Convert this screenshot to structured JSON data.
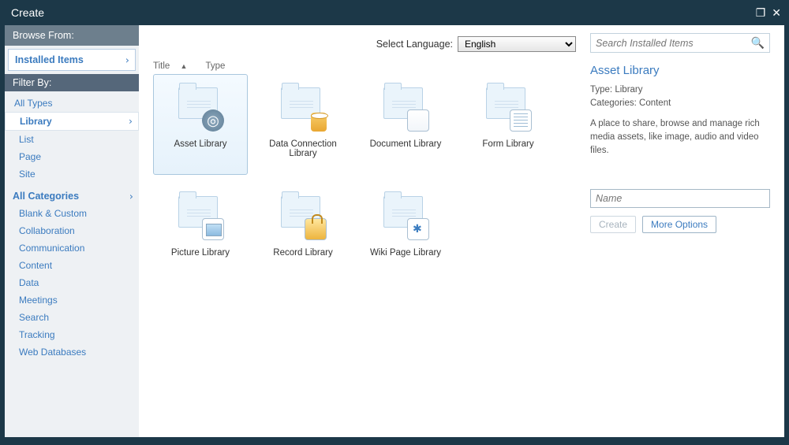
{
  "window": {
    "title": "Create"
  },
  "sidebar": {
    "browse_from": "Browse From:",
    "installed_items": "Installed Items",
    "filter_by": "Filter By:",
    "all_types": "All Types",
    "types": [
      "Library",
      "List",
      "Page",
      "Site"
    ],
    "selected_type_index": 0,
    "all_categories": "All Categories",
    "categories": [
      "Blank & Custom",
      "Collaboration",
      "Communication",
      "Content",
      "Data",
      "Meetings",
      "Search",
      "Tracking",
      "Web Databases"
    ]
  },
  "language": {
    "label": "Select Language:",
    "selected": "English"
  },
  "sort": {
    "label_title": "Title",
    "label_type": "Type"
  },
  "items": [
    {
      "label": "Asset Library",
      "overlay": "reel",
      "selected": true
    },
    {
      "label": "Data Connection Library",
      "overlay": "db",
      "selected": false
    },
    {
      "label": "Document Library",
      "overlay": "doc",
      "selected": false
    },
    {
      "label": "Form Library",
      "overlay": "form",
      "selected": false
    },
    {
      "label": "Picture Library",
      "overlay": "pic",
      "selected": false
    },
    {
      "label": "Record Library",
      "overlay": "lock",
      "selected": false
    },
    {
      "label": "Wiki Page Library",
      "overlay": "wiki",
      "selected": false
    }
  ],
  "search": {
    "placeholder": "Search Installed Items"
  },
  "right_panel": {
    "title": "Asset Library",
    "type_label": "Type:",
    "type_value": "Library",
    "categories_label": "Categories:",
    "categories_value": "Content",
    "description": "A place to share, browse and manage rich media assets, like image, audio and video files.",
    "name_placeholder": "Name",
    "create_label": "Create",
    "more_options_label": "More Options"
  }
}
